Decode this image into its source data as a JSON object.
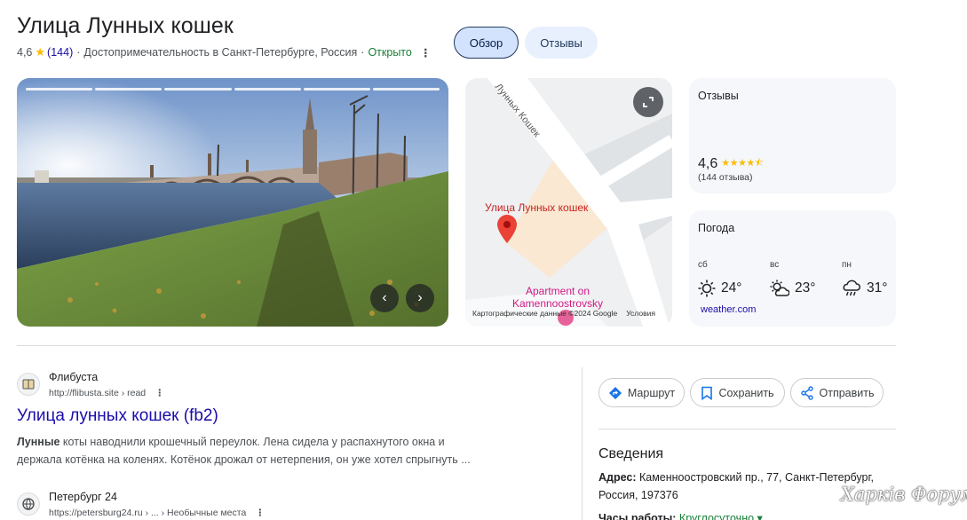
{
  "place": {
    "title": "Улица Лунных кошек",
    "rating": "4,6",
    "reviews_count": "(144)",
    "category": "Достопримечательность в Санкт-Петербурге, Россия",
    "separator": "·",
    "status": "Открыто"
  },
  "tabs": [
    {
      "label": "Обзор",
      "active": true
    },
    {
      "label": "Отзывы",
      "active": false
    }
  ],
  "map": {
    "pin_label": "Улица Лунных кошек",
    "poi_label": "Apartment on Kamennoostrovsky",
    "street_label": "Лунных Кошек",
    "copyright": "Картографические данные ©2024 Google",
    "terms": "Условия"
  },
  "reviews_card": {
    "title": "Отзывы",
    "score": "4,6",
    "count_text": "(144 отзыва)"
  },
  "weather_card": {
    "title": "Погода",
    "days": [
      {
        "day": "сб",
        "temp": "24°",
        "icon": "sun-icon"
      },
      {
        "day": "вс",
        "temp": "23°",
        "icon": "partly-cloudy-icon"
      },
      {
        "day": "пн",
        "temp": "31°",
        "icon": "rain-cloud-icon"
      }
    ],
    "source": "weather.com"
  },
  "results": [
    {
      "site": "Флибуста",
      "url": "http://flibusta.site › read",
      "title": "Улица лунных кошек (fb2)",
      "snippet_bold": "Лунные",
      "snippet": " коты наводнили крошечный переулок. Лена сидела у распахнутого окна и держала котёнка на коленях. Котёнок дрожал от нетерпения, он уже хотел спрыгнуть ..."
    },
    {
      "site": "Петербург 24",
      "url": "https://petersburg24.ru › ... › Необычные места"
    }
  ],
  "actions": {
    "route": "Маршрут",
    "save": "Сохранить",
    "share": "Отправить"
  },
  "info": {
    "title": "Сведения",
    "address_label": "Адрес:",
    "address": " Каменноостровский пр., 77, Санкт-Петербург, Россия, 197376",
    "hours_label": "Часы работы:",
    "hours": " Круглосуточно ▾"
  },
  "watermark": "Харків Форум",
  "colors": {
    "link": "#1a0dab",
    "open": "#188038",
    "star": "#fbbc04",
    "active_tab_bg": "#d3e3fd",
    "pin": "#ea4335"
  }
}
